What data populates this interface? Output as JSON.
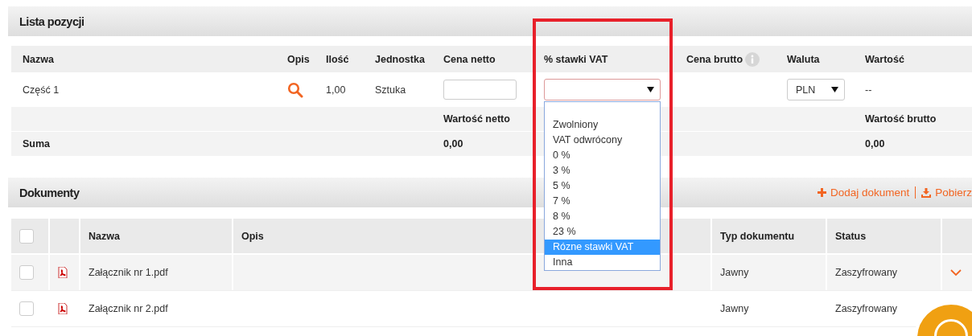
{
  "items_panel": {
    "title": "Lista pozycji",
    "columns": [
      "Nazwa",
      "Opis",
      "Ilość",
      "Jednostka",
      "Cena netto",
      "% stawki VAT",
      "Cena brutto",
      "Waluta",
      "Wartość"
    ],
    "row": {
      "name": "Część 1",
      "quantity": "1,00",
      "unit": "Sztuka",
      "currency": "PLN",
      "value": "--"
    },
    "sum_labels": {
      "net": "Wartość netto",
      "gross": "Wartość brutto"
    },
    "sum_row": {
      "label": "Suma",
      "net": "0,00",
      "gross": "0,00"
    },
    "vat_options": [
      {
        "label": "Zwolniony",
        "selected": false
      },
      {
        "label": "VAT odwrócony",
        "selected": false
      },
      {
        "label": "0 %",
        "selected": false
      },
      {
        "label": "3 %",
        "selected": false
      },
      {
        "label": "5 %",
        "selected": false
      },
      {
        "label": "7 %",
        "selected": false
      },
      {
        "label": "8 %",
        "selected": false
      },
      {
        "label": "23 %",
        "selected": false
      },
      {
        "label": "Rózne stawki VAT",
        "selected": true
      },
      {
        "label": "Inna",
        "selected": false
      }
    ]
  },
  "documents_panel": {
    "title": "Dokumenty",
    "actions": [
      {
        "kind": "add",
        "label": "Dodaj dokument"
      },
      {
        "kind": "download",
        "label": "Pobierz"
      }
    ],
    "columns": [
      "Nazwa",
      "Opis",
      "Typ dokumentu",
      "Status"
    ],
    "header_checked": false,
    "rows": [
      {
        "checked": false,
        "name": "Załącznik nr 1.pdf",
        "type": "Jawny",
        "status": "Zaszyfrowany"
      },
      {
        "checked": false,
        "name": "Załącznik nr 2.pdf",
        "type": "Jawny",
        "status": "Zaszyfrowany"
      }
    ]
  }
}
